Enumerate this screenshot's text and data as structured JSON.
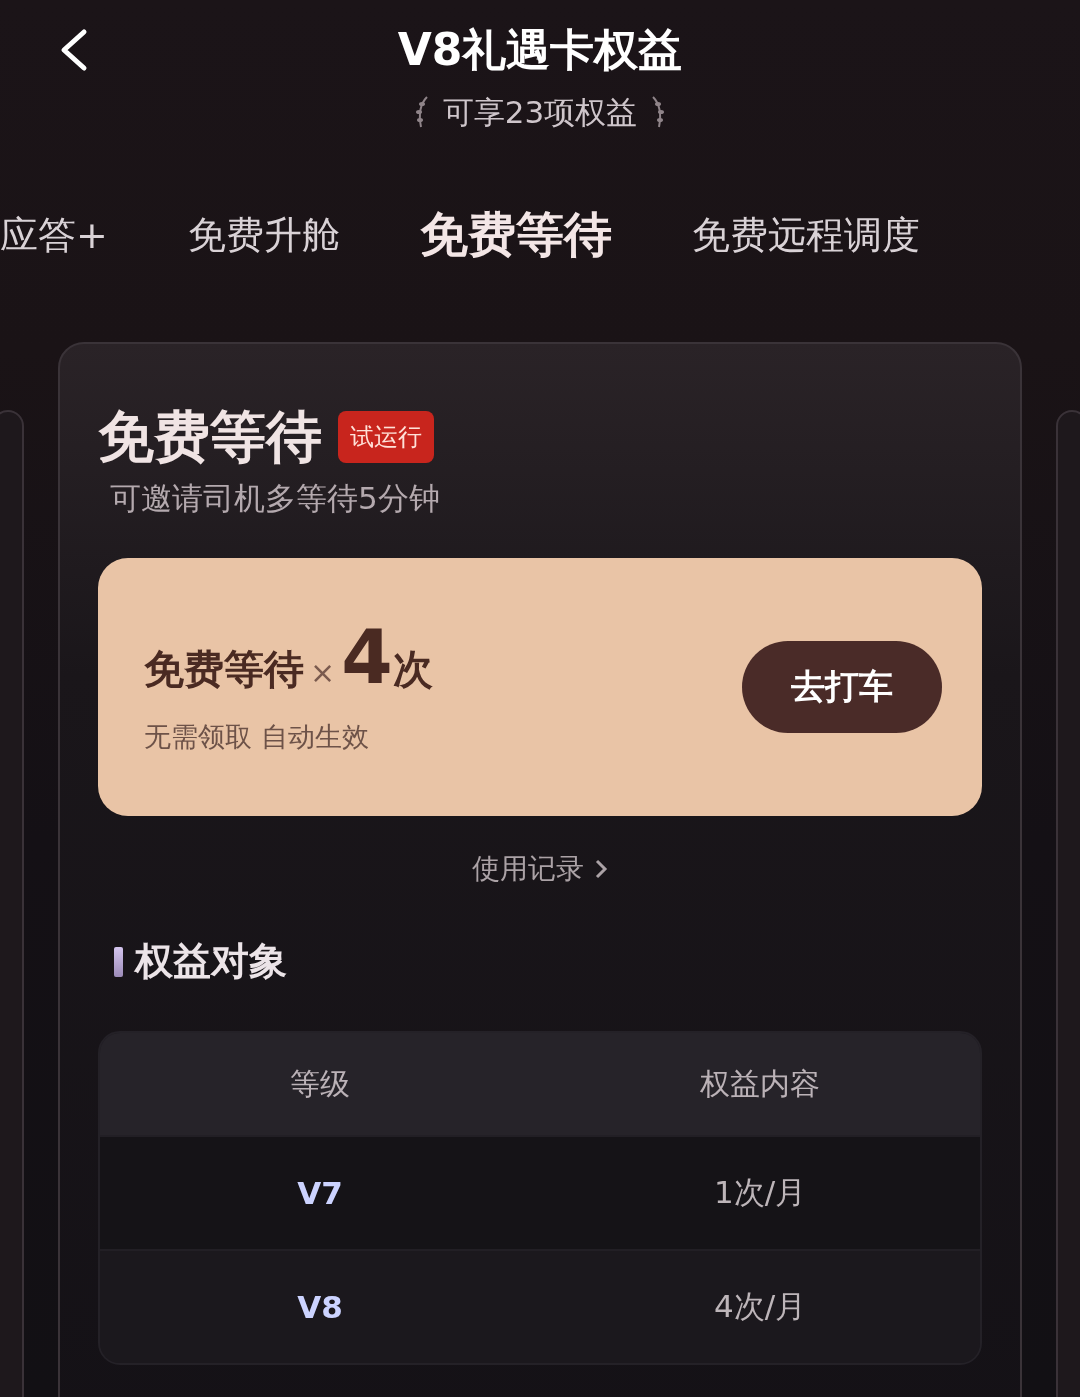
{
  "header": {
    "title": "V8礼遇卡权益",
    "subtitle": "可享23项权益"
  },
  "tabs": [
    {
      "label": "应答+",
      "selected": false
    },
    {
      "label": "免费升舱",
      "selected": false
    },
    {
      "label": "免费等待",
      "selected": true
    },
    {
      "label": "免费远程调度",
      "selected": false
    }
  ],
  "card": {
    "title": "免费等待",
    "badge": "试运行",
    "description": "可邀请司机多等待5分钟",
    "offer": {
      "name": "免费等待",
      "times_sign": "×",
      "count": "4",
      "unit": "次",
      "note": "无需领取 自动生效",
      "button": "去打车"
    },
    "history_link": "使用记录",
    "section_title": "权益对象",
    "table": {
      "columns": [
        "等级",
        "权益内容"
      ],
      "rows": [
        [
          "V7",
          "1次/月"
        ],
        [
          "V8",
          "4次/月"
        ]
      ]
    }
  }
}
